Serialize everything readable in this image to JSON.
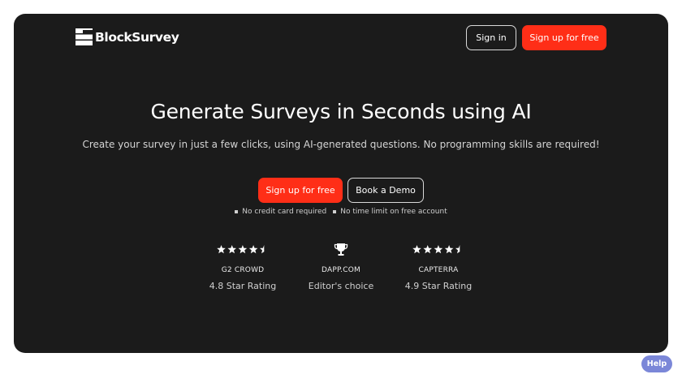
{
  "header": {
    "logo_icon": "blocksurvey-logo-icon",
    "logo_text": "BlockSurvey",
    "signin_label": "Sign in",
    "signup_label": "Sign up for free"
  },
  "hero": {
    "headline": "Generate Surveys in Seconds using AI",
    "subline": "Create your survey in just a few clicks, using AI-generated questions. No programming skills are required!",
    "cta_primary": "Sign up for free",
    "cta_secondary": "Book a Demo",
    "notes": [
      "No credit card required",
      "No time limit on free account"
    ]
  },
  "ratings": [
    {
      "source": "G2 CROWD",
      "label": "4.8 Star Rating",
      "stars": 4.5,
      "icon": "star-icon"
    },
    {
      "source": "DAPP.COM",
      "label": "Editor's choice",
      "icon": "trophy-icon"
    },
    {
      "source": "CAPTERRA",
      "label": "4.9 Star Rating",
      "stars": 4.5,
      "icon": "star-icon"
    }
  ],
  "help": {
    "label": "Help"
  },
  "colors": {
    "hero_bg": "#1b1b1b",
    "accent": "#ff2e17",
    "help_bg": "#7b87d8"
  }
}
